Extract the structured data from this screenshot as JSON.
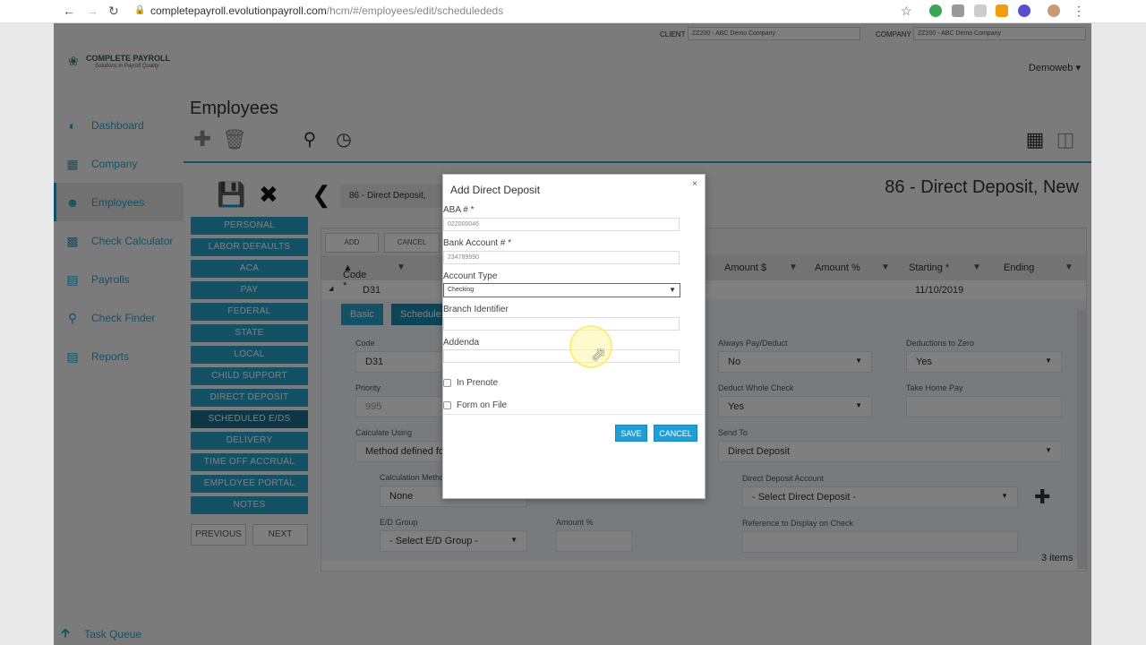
{
  "browser": {
    "url_host": "completepayroll.evolutionpayroll.com",
    "url_path": "/hcm/#/employees/edit/schedulededs"
  },
  "topbar": {
    "client_label": "CLIENT",
    "client_value": "ZZ200 - ABC Demo Company",
    "company_label": "COMPANY",
    "company_value": "ZZ200 - ABC Demo Company"
  },
  "logo": {
    "title": "COMPLETE PAYROLL",
    "tagline": "Solutions in Payroll Quality"
  },
  "user": {
    "name": "Demoweb"
  },
  "sidebar": {
    "items": [
      {
        "label": "Dashboard",
        "icon": "dashboard-icon"
      },
      {
        "label": "Company",
        "icon": "building-icon"
      },
      {
        "label": "Employees",
        "icon": "person-icon"
      },
      {
        "label": "Check Calculator",
        "icon": "calculator-icon"
      },
      {
        "label": "Payrolls",
        "icon": "payroll-icon"
      },
      {
        "label": "Check Finder",
        "icon": "search-icon"
      },
      {
        "label": "Reports",
        "icon": "report-icon"
      }
    ],
    "task_queue": "Task Queue"
  },
  "page": {
    "title": "Employees",
    "employee_short": "86 - Direct Deposit,",
    "employee_full": "86 - Direct Deposit, New"
  },
  "tabs": [
    "PERSONAL",
    "LABOR DEFAULTS",
    "ACA",
    "PAY",
    "FEDERAL",
    "STATE",
    "LOCAL",
    "CHILD SUPPORT",
    "DIRECT DEPOSIT",
    "SCHEDULED E/DS",
    "DELIVERY",
    "TIME OFF ACCRUAL",
    "EMPLOYEE PORTAL",
    "NOTES"
  ],
  "pager": {
    "previous": "PREVIOUS",
    "next": "NEXT"
  },
  "grid": {
    "add": "ADD",
    "cancel": "CANCEL",
    "columns": [
      "Code *",
      "Amount $",
      "Amount %",
      "Starting *",
      "Ending"
    ],
    "row": {
      "code": "D31",
      "starting": "11/10/2019"
    },
    "detail_tabs": [
      "Basic",
      "Schedule"
    ],
    "fields": {
      "code_label": "Code",
      "code_value": "D31",
      "priority_label": "Priority",
      "priority_value": "995",
      "calc_using_label": "Calculate Using",
      "calc_using_value": "Method defined fo",
      "calc_method_label": "Calculation Metho",
      "calc_method_value": "None",
      "ed_group_label": "E/D Group",
      "ed_group_value": "- Select E/D Group -",
      "amount_pct_label": "Amount %",
      "always_pay_label": "Always Pay/Deduct",
      "always_pay_value": "No",
      "deductions_zero_label": "Deductions to Zero",
      "deductions_zero_value": "Yes",
      "deduct_whole_label": "Deduct Whole Check",
      "deduct_whole_value": "Yes",
      "take_home_label": "Take Home Pay",
      "send_to_label": "Send To",
      "send_to_value": "Direct Deposit",
      "dd_account_label": "Direct Deposit Account",
      "dd_account_value": "- Select Direct Deposit -",
      "reference_label": "Reference to Display on Check"
    },
    "items_count": "3 items"
  },
  "modal": {
    "title": "Add Direct Deposit",
    "aba_label": "ABA # *",
    "aba_value": "022000046",
    "bank_label": "Bank Account # *",
    "bank_value": "234789990",
    "account_type_label": "Account Type",
    "account_type_value": "Checking",
    "branch_label": "Branch Identifier",
    "addenda_label": "Addenda",
    "prenote_label": "In Prenote",
    "form_on_file_label": "Form on File",
    "save": "SAVE",
    "cancel": "CANCEL"
  }
}
